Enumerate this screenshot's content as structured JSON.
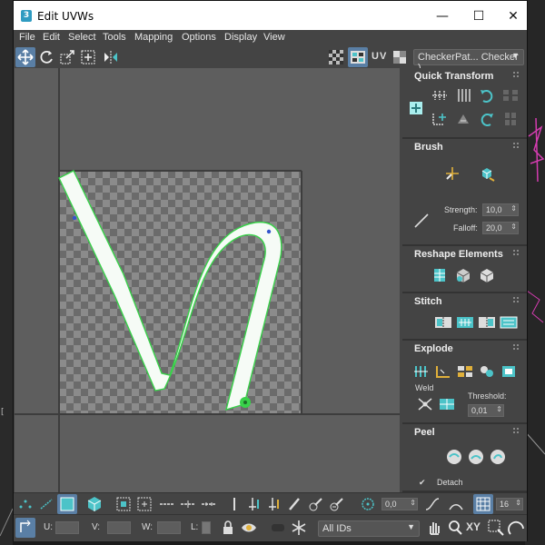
{
  "window": {
    "title": "Edit UVWs"
  },
  "menu": [
    "File",
    "Edit",
    "Select",
    "Tools",
    "Mapping",
    "Options",
    "Display",
    "View"
  ],
  "toolbar": {
    "uv_label": "UV",
    "map_dropdown": "CheckerPat... Checker )"
  },
  "panels": {
    "quick_transform": {
      "title": "Quick Transform"
    },
    "brush": {
      "title": "Brush",
      "strength_label": "Strength:",
      "strength_value": "10,0",
      "falloff_label": "Falloff:",
      "falloff_value": "20,0"
    },
    "reshape": {
      "title": "Reshape Elements"
    },
    "stitch": {
      "title": "Stitch"
    },
    "explode": {
      "title": "Explode",
      "weld_label": "Weld",
      "threshold_label": "Threshold:",
      "threshold_value": "0,01"
    },
    "peel": {
      "title": "Peel",
      "detach_label": "Detach"
    }
  },
  "bottom": {
    "angle_value": "0,0",
    "grid_value": "16",
    "u_label": "U:",
    "v_label": "V:",
    "w_label": "W:",
    "l_label": "L:",
    "xy_label": "XY",
    "ids_dropdown": "All IDs"
  },
  "colors": {
    "accent_teal": "#4cc3c8",
    "active_button": "#5a7fa5",
    "uv_edge": "#39d14a"
  }
}
